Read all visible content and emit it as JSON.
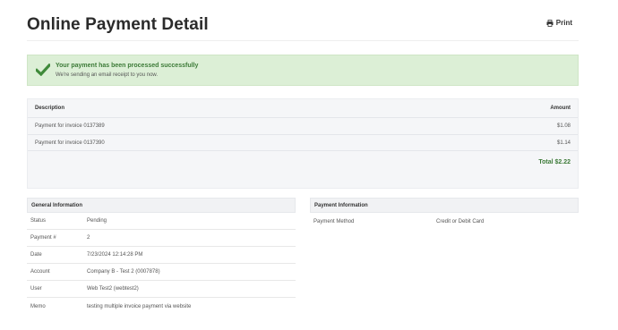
{
  "header": {
    "title": "Online Payment Detail",
    "print_label": "Print"
  },
  "alert": {
    "title": "Your payment has been processed successfully",
    "message": "We're sending an email receipt to you now."
  },
  "invoices": {
    "columns": [
      "Description",
      "Amount"
    ],
    "rows": [
      {
        "description": "Payment for invoice 0137389",
        "amount": "$1.08"
      },
      {
        "description": "Payment for invoice 0137390",
        "amount": "$1.14"
      }
    ],
    "total": "Total $2.22"
  },
  "general_info": {
    "header": "General Information",
    "rows": [
      {
        "label": "Status",
        "value": "Pending"
      },
      {
        "label": "Payment #",
        "value": "2"
      },
      {
        "label": "Date",
        "value": "7/23/2024 12:14:28 PM"
      },
      {
        "label": "Account",
        "value": "Company B - Test 2 (0007878)"
      },
      {
        "label": "User",
        "value": "Web Test2 (webtest2)"
      },
      {
        "label": "Memo",
        "value": "testing multiple invoice payment via website"
      }
    ]
  },
  "payment_info": {
    "header": "Payment Information",
    "rows": [
      {
        "label": "Payment Method",
        "value": "Credit or Debit Card"
      }
    ]
  },
  "colors": {
    "success_green": "#3c7a37",
    "alert_bg": "#dcefd6",
    "check_green": "#3f8a3a"
  },
  "icons": {
    "print": "printer-icon",
    "success": "checkmark-icon"
  }
}
